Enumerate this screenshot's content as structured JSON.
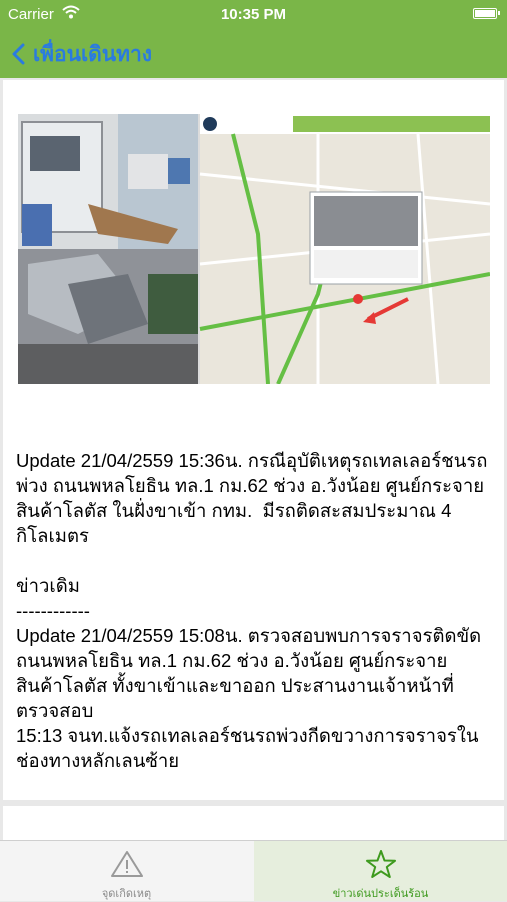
{
  "status_bar": {
    "carrier": "Carrier",
    "time": "10:35 PM"
  },
  "nav": {
    "back_label": "เพื่อนเดินทาง"
  },
  "post": {
    "image_icons": [
      "accident-photo-icon",
      "map-icon"
    ],
    "text": "Update 21/04/2559 15:36น. กรณีอุบัติเหตุรถเทลเลอร์ชนรถพ่วง ถนนพหลโยธิน ทล.1 กม.62 ช่วง อ.วังน้อย ศูนย์กระจายสินค้าโลตัส ในฝั่งขาเข้า กทม.  มีรถติดสะสมประมาณ 4 กิโลเมตร\n\nข่าวเดิม\n------------\nUpdate 21/04/2559 15:08น. ตรวจสอบพบการจราจรติดขัด ถนนพหลโยธิน ทล.1 กม.62 ช่วง อ.วังน้อย ศูนย์กระจายสินค้าโลตัส ทั้งขาเข้าและขาออก ประสานงานเจ้าหน้าที่ตรวจสอบ\n15:13 จนท.แจ้งรถเทลเลอร์ชนรถพ่วงกีดขวางการจราจรในช่องทางหลักเลนซ้าย"
  },
  "tabs": [
    {
      "label": "จุดเกิดเหตุ",
      "icon": "warning-icon",
      "active": false
    },
    {
      "label": "ข่าวเด่นประเด็นร้อน",
      "icon": "star-icon",
      "active": true
    }
  ],
  "colors": {
    "bar_green": "#7ab648",
    "nav_blue": "#2a7be0",
    "active_tab": "#3e9a1e"
  }
}
